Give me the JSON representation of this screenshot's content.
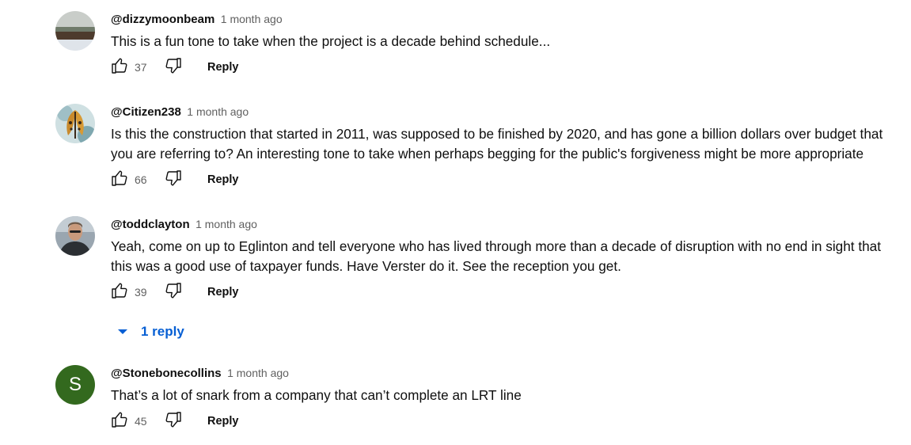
{
  "comments": [
    {
      "author": "@dizzymoonbeam",
      "time": "1 month ago",
      "text": "This is a fun tone to take when the project is a decade behind schedule...",
      "likes": "37",
      "reply_label": "Reply",
      "avatar_kind": "landscape-photo"
    },
    {
      "author": "@Citizen238",
      "time": "1 month ago",
      "text": "Is this the construction that started in 2011, was supposed to be finished by 2020, and has gone a billion dollars over budget that you are referring to? An interesting tone to take when perhaps begging for the public's forgiveness might be more appropriate",
      "likes": "66",
      "reply_label": "Reply",
      "avatar_kind": "butterfly-photo"
    },
    {
      "author": "@toddclayton",
      "time": "1 month ago",
      "text": "Yeah, come on up to Eglinton and tell everyone who has lived through more than a decade of disruption with no end in sight that this was a good use of taxpayer funds. Have Verster do it. See the reception you get.",
      "likes": "39",
      "reply_label": "Reply",
      "avatar_kind": "person-photo",
      "replies_label": "1 reply"
    },
    {
      "author": "@Stonebonecollins",
      "time": "1 month ago",
      "text": "That’s a lot of snark from a company that can’t complete an LRT line",
      "likes": "45",
      "reply_label": "Reply",
      "avatar_letter": "S",
      "avatar_color": "#33691e"
    }
  ],
  "colors": {
    "link_blue": "#065fd4",
    "secondary_text": "#606060",
    "primary_text": "#0f0f0f"
  },
  "icons": {
    "like": "thumbs-up-icon",
    "dislike": "thumbs-down-icon",
    "expand": "caret-down-icon"
  }
}
